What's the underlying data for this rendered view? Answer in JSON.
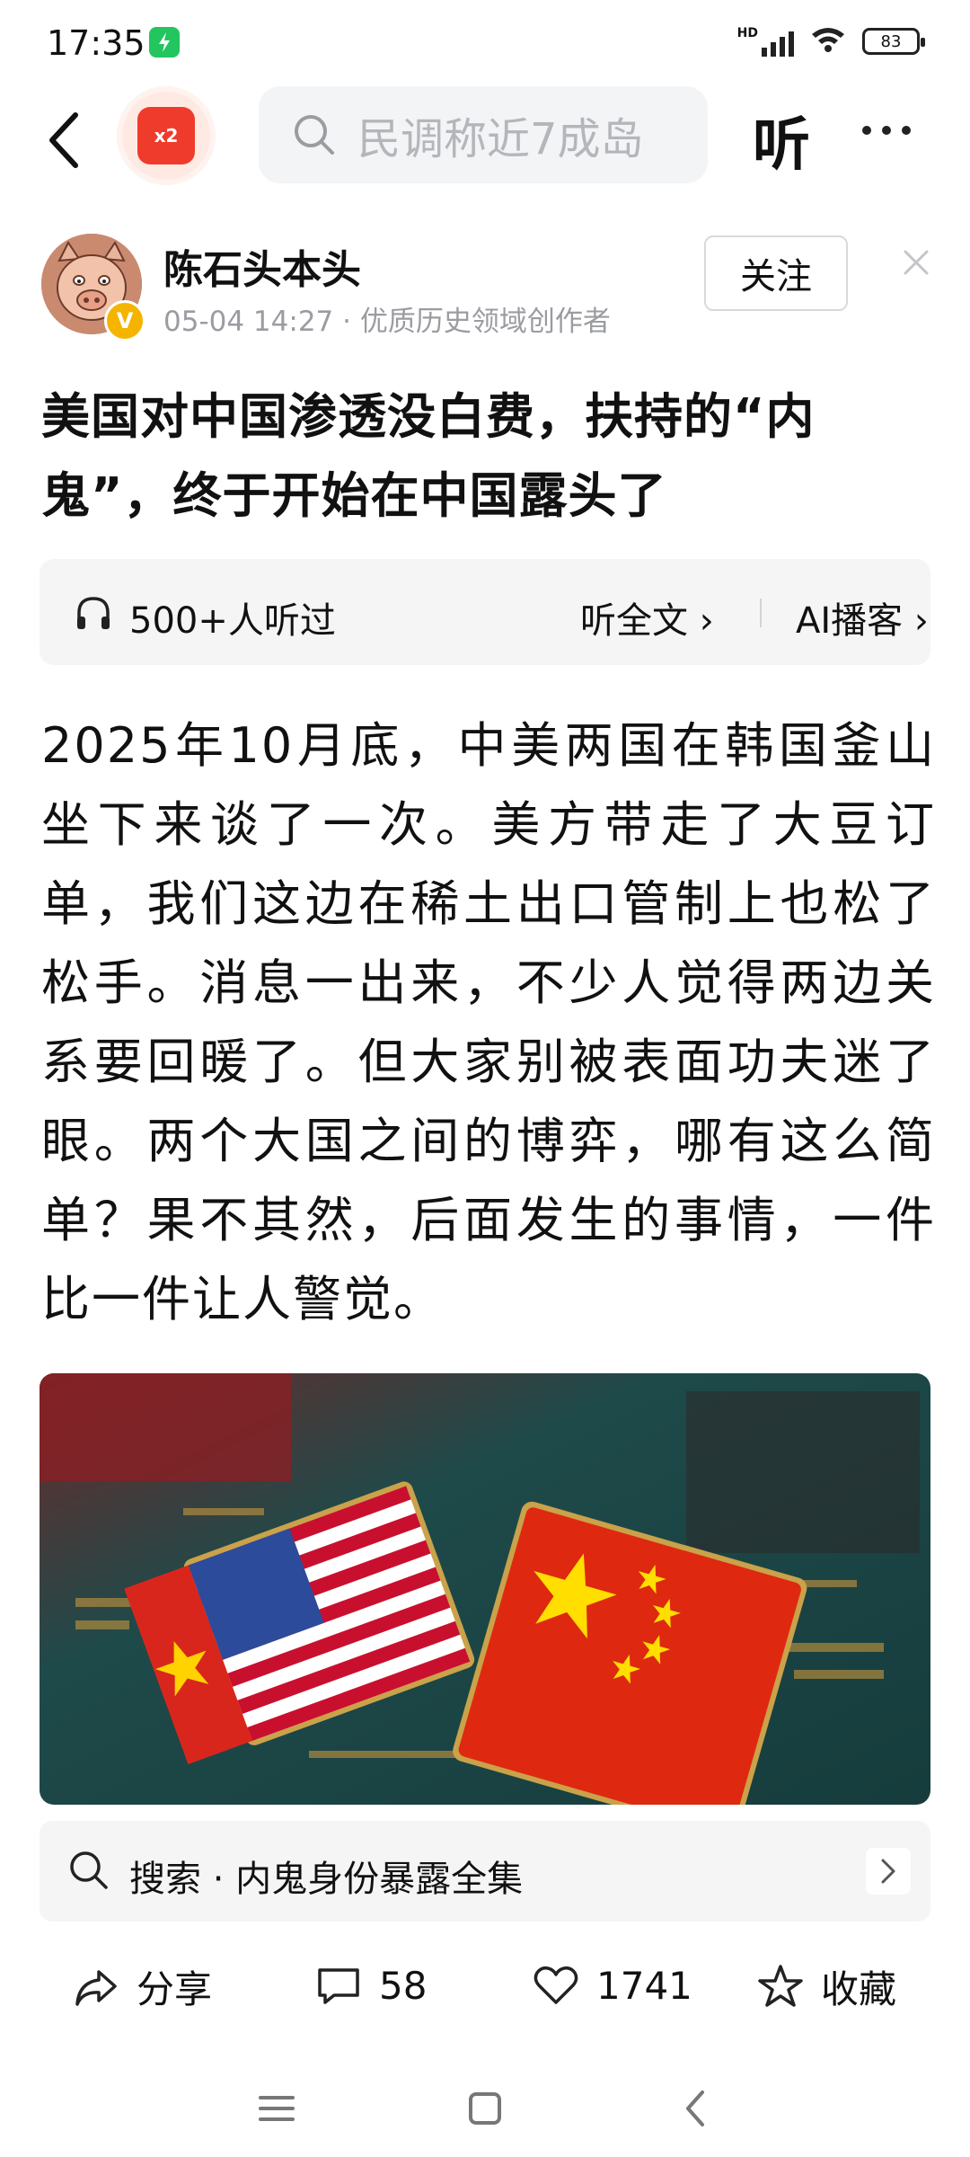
{
  "status_bar": {
    "time": "17:35",
    "network": "HD",
    "battery": "83"
  },
  "top_nav": {
    "reward_label": "x2",
    "search_placeholder": "民调称近7成岛",
    "listen_label": "听"
  },
  "author": {
    "name": "陈石头本头",
    "meta": "05-04 14:27 · 优质历史领域创作者",
    "verified_mark": "V",
    "follow_label": "关注"
  },
  "article": {
    "title": "美国对中国渗透没白费，扶持的“内鬼”，终于开始在中国露头了",
    "body": "2025年10月底，中美两国在韩国釜山坐下来谈了一次。美方带走了大豆订单，我们这边在稀土出口管制上也松了松手。消息一出来，不少人觉得两边关系要回暖了。但大家别被表面功夫迷了眼。两个大国之间的博弈，哪有这么简单？果不其然，后面发生的事情，一件比一件让人警觉。"
  },
  "audio": {
    "listen_count": "500+人听过",
    "full_text_label": "听全文",
    "ai_podcast_label": "AI播客"
  },
  "related_search": {
    "text": "搜索 · 内鬼身份暴露全集"
  },
  "actions": {
    "share_label": "分享",
    "comments_count": "58",
    "likes_count": "1741",
    "favorite_label": "收藏"
  },
  "colors": {
    "accent_red": "#ef3b2c",
    "badge_gold": "#f5b400",
    "battery_saver_green": "#22c55e"
  }
}
